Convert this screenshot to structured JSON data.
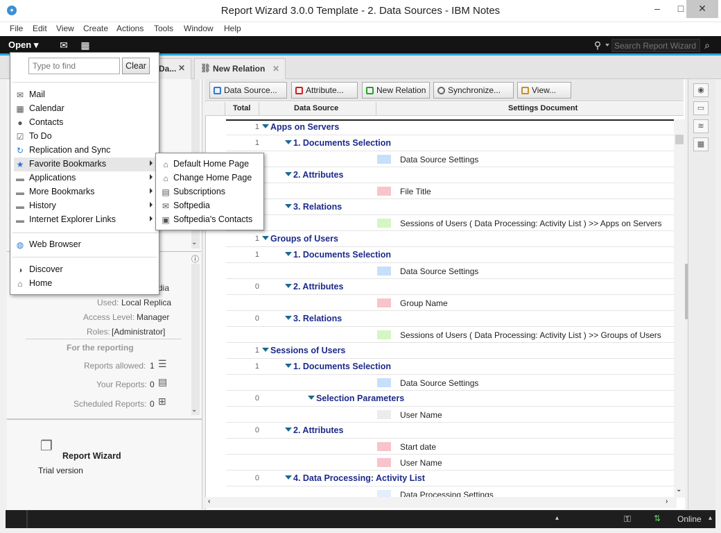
{
  "window": {
    "title": "Report Wizard 3.0.0 Template - 2. Data Sources - IBM Notes",
    "minimize": "–",
    "maximize": "□",
    "close": "✕"
  },
  "menu": [
    "File",
    "Edit",
    "View",
    "Create",
    "Actions",
    "Tools",
    "Window",
    "Help"
  ],
  "toolbar": {
    "open_label": "Open",
    "search_placeholder": "Search Report Wizard"
  },
  "tabs": [
    {
      "label": "Da..."
    },
    {
      "label": "New Relation"
    }
  ],
  "open_menu": {
    "find_placeholder": "Type to find",
    "clear_label": "Clear",
    "items": [
      {
        "label": "Mail",
        "icon": "mail-icon"
      },
      {
        "label": "Calendar",
        "icon": "calendar-icon"
      },
      {
        "label": "Contacts",
        "icon": "contacts-icon"
      },
      {
        "label": "To Do",
        "icon": "todo-icon"
      },
      {
        "label": "Replication and Sync",
        "icon": "replication-icon"
      },
      {
        "label": "Favorite Bookmarks",
        "icon": "favorite-icon",
        "submenu": true
      },
      {
        "label": "Applications",
        "icon": "folder-icon",
        "submenu": true
      },
      {
        "label": "More Bookmarks",
        "icon": "folder-icon",
        "submenu": true
      },
      {
        "label": "History",
        "icon": "folder-icon",
        "submenu": true
      },
      {
        "label": "Internet Explorer Links",
        "icon": "folder-icon",
        "submenu": true
      }
    ],
    "web_browser": "Web Browser",
    "discover": "Discover",
    "home": "Home",
    "submenu": [
      "Default Home Page",
      "Change Home Page",
      "Subscriptions",
      "Softpedia",
      "Softpedia's Contacts"
    ]
  },
  "left_panel": {
    "partial_text": "dia",
    "used_label": "Used:",
    "used_value": "Local Replica",
    "access_label": "Access Level:",
    "access_value": "Manager",
    "roles_label": "Roles:",
    "roles_value": "[Administrator]",
    "reporting_heading": "For the reporting",
    "reports_allowed_label": "Reports allowed:",
    "reports_allowed_value": "1",
    "your_reports_label": "Your Reports:",
    "your_reports_value": "0",
    "scheduled_label": "Scheduled Reports:",
    "scheduled_value": "0",
    "app_name": "Report Wizard",
    "app_edition": "Trial version"
  },
  "action_buttons": [
    {
      "label": "Data Source...",
      "color": "#2a7bd6"
    },
    {
      "label": "Attribute...",
      "color": "#d02020"
    },
    {
      "label": "New Relation",
      "color": "#2aa02a"
    },
    {
      "label": "Synchronize...",
      "color": "#666666"
    },
    {
      "label": "View...",
      "color": "#c89020"
    }
  ],
  "columns": {
    "total": "Total",
    "data_source": "Data Source",
    "settings": "Settings Document"
  },
  "rows": [
    {
      "num": "1",
      "level": 0,
      "label": "Apps on Servers"
    },
    {
      "num": "1",
      "level": 1,
      "label": "1. Documents Selection"
    },
    {
      "num": "",
      "level": 2,
      "doc": "Data Source Settings",
      "swatch": "#c6e0fb"
    },
    {
      "num": "",
      "level": 1,
      "label": "2. Attributes"
    },
    {
      "num": "",
      "level": 2,
      "doc": "File Title",
      "swatch": "#f8c4cc"
    },
    {
      "num": "",
      "level": 1,
      "label": "3. Relations"
    },
    {
      "num": "",
      "level": 2,
      "doc": "Sessions of Users ( Data Processing: Activity List ) >> Apps on Servers",
      "swatch": "#d6f5c4"
    },
    {
      "num": "1",
      "level": 0,
      "label": "Groups of Users"
    },
    {
      "num": "1",
      "level": 1,
      "label": "1. Documents Selection"
    },
    {
      "num": "",
      "level": 2,
      "doc": "Data Source Settings",
      "swatch": "#c6e0fb"
    },
    {
      "num": "0",
      "level": 1,
      "label": "2. Attributes"
    },
    {
      "num": "",
      "level": 2,
      "doc": "Group Name",
      "swatch": "#f8c4cc"
    },
    {
      "num": "0",
      "level": 1,
      "label": "3. Relations"
    },
    {
      "num": "",
      "level": 2,
      "doc": "Sessions of Users ( Data Processing: Activity List ) >> Groups of Users",
      "swatch": "#d6f5c4"
    },
    {
      "num": "1",
      "level": 0,
      "label": "Sessions of Users"
    },
    {
      "num": "1",
      "level": 1,
      "label": "1. Documents Selection"
    },
    {
      "num": "",
      "level": 2,
      "doc": "Data Source Settings",
      "swatch": "#c6e0fb"
    },
    {
      "num": "0",
      "level": 3,
      "label": "Selection Parameters"
    },
    {
      "num": "",
      "level": 2,
      "doc": "User Name",
      "swatch": "#ececec"
    },
    {
      "num": "0",
      "level": 1,
      "label": "2. Attributes"
    },
    {
      "num": "",
      "level": 2,
      "doc": "Start date",
      "swatch": "#f8c4cc"
    },
    {
      "num": "",
      "level": 2,
      "doc": "User Name",
      "swatch": "#f8c4cc"
    },
    {
      "num": "0",
      "level": 1,
      "label": "4. Data Processing: Activity List"
    },
    {
      "num": "",
      "level": 2,
      "doc": "Data Processing Settings",
      "swatch": "#e2eefc"
    }
  ],
  "status": {
    "online": "Online"
  }
}
